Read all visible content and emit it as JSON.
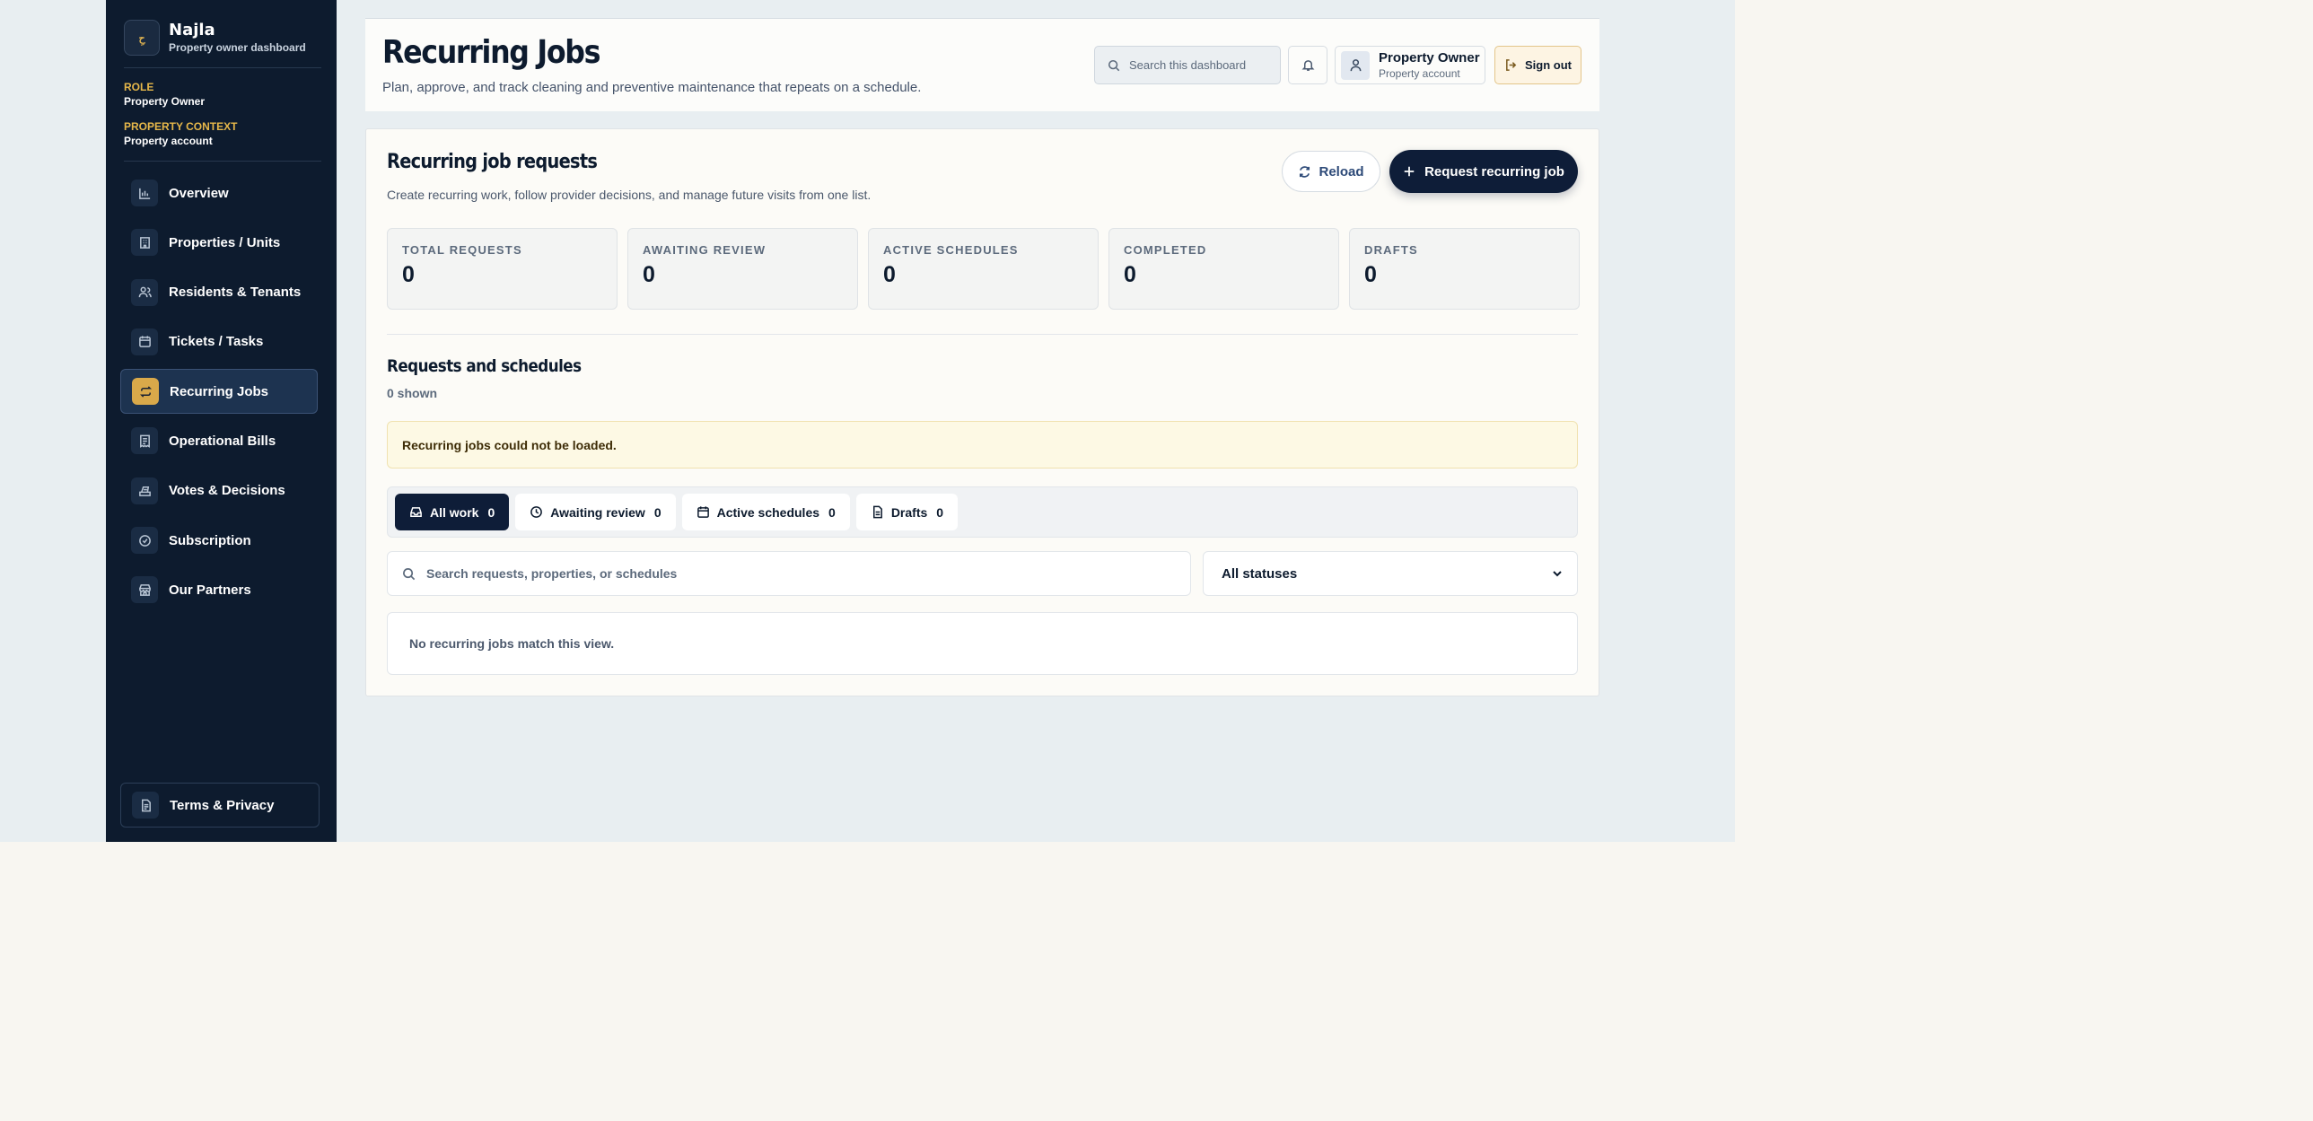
{
  "brand": {
    "logo_text": "حِ",
    "name": "Najla",
    "subtitle": "Property owner dashboard"
  },
  "context": {
    "role_label": "ROLE",
    "role_value": "Property Owner",
    "property_label": "PROPERTY CONTEXT",
    "property_value": "Property account"
  },
  "sidebar": {
    "items": [
      {
        "label": "Overview",
        "icon": "chart-icon"
      },
      {
        "label": "Properties / Units",
        "icon": "building-icon"
      },
      {
        "label": "Residents & Tenants",
        "icon": "users-icon"
      },
      {
        "label": "Tickets / Tasks",
        "icon": "calendar-icon"
      },
      {
        "label": "Recurring Jobs",
        "icon": "repeat-icon",
        "active": true
      },
      {
        "label": "Operational Bills",
        "icon": "receipt-icon"
      },
      {
        "label": "Votes & Decisions",
        "icon": "vote-icon"
      },
      {
        "label": "Subscription",
        "icon": "check-circle-icon"
      },
      {
        "label": "Our Partners",
        "icon": "store-icon"
      }
    ],
    "footer_label": "Terms & Privacy"
  },
  "header": {
    "title": "Recurring Jobs",
    "subtitle": "Plan, approve, and track cleaning and preventive maintenance that repeats on a schedule.",
    "search_placeholder": "Search this dashboard",
    "user_name": "Property Owner",
    "user_account": "Property account",
    "signout_label": "Sign out"
  },
  "main": {
    "title": "Recurring job requests",
    "description": "Create recurring work, follow provider decisions, and manage future visits from one list.",
    "reload_label": "Reload",
    "request_label": "Request recurring job",
    "stats": [
      {
        "label": "TOTAL REQUESTS",
        "value": "0"
      },
      {
        "label": "AWAITING REVIEW",
        "value": "0"
      },
      {
        "label": "ACTIVE SCHEDULES",
        "value": "0"
      },
      {
        "label": "COMPLETED",
        "value": "0"
      },
      {
        "label": "DRAFTS",
        "value": "0"
      }
    ],
    "list_title": "Requests and schedules",
    "list_count": "0 shown",
    "alert": "Recurring jobs could not be loaded.",
    "tabs": [
      {
        "label": "All work",
        "count": "0",
        "icon": "inbox-icon",
        "active": true
      },
      {
        "label": "Awaiting review",
        "count": "0",
        "icon": "clock-icon"
      },
      {
        "label": "Active schedules",
        "count": "0",
        "icon": "calendar-icon"
      },
      {
        "label": "Drafts",
        "count": "0",
        "icon": "document-icon"
      }
    ],
    "search_placeholder": "Search requests, properties, or schedules",
    "status_filter": "All statuses",
    "empty": "No recurring jobs match this view."
  }
}
